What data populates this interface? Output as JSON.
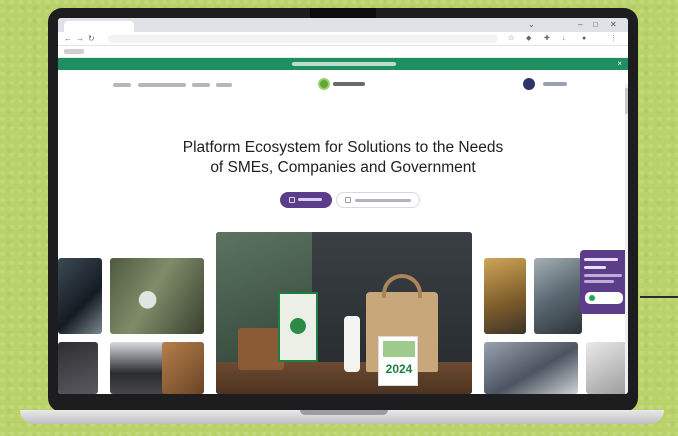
{
  "hero": {
    "title_line1": "Platform Ecosystem for Solutions to the Needs",
    "title_line2": "of SMEs, Companies and Government"
  },
  "products": {
    "calendar_year": "2024"
  },
  "colors": {
    "background": "#b9d36a",
    "promo_bar": "#1f8f60",
    "primary_button": "#5c3d8a",
    "chat_widget": "#5c3d8a"
  },
  "icons": {
    "back": "arrow-left-icon",
    "forward": "arrow-right-icon",
    "reload": "reload-icon",
    "close": "close-icon",
    "minimize": "minimize-icon",
    "maximize": "maximize-icon",
    "extensions": "puzzle-icon",
    "profile": "profile-icon",
    "menu": "kebab-menu-icon",
    "whatsapp": "whatsapp-icon"
  }
}
